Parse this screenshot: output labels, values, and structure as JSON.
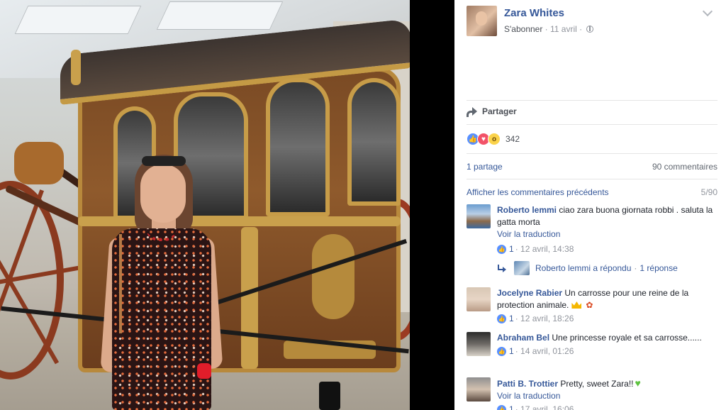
{
  "post": {
    "author": "Zara Whites",
    "follow_label": "S'abonner",
    "separator": " · ",
    "date": "11 avril",
    "share_label": "Partager",
    "reaction_count": "342",
    "shares": "1 partage",
    "comments_total": "90 commentaires",
    "view_previous": "Afficher les commentaires précédents",
    "comments_shown": "5/90"
  },
  "icons": {
    "chevron": "chevron-down-icon",
    "globe": "globe-icon",
    "share": "share-arrow-icon",
    "reactions": [
      "like-icon",
      "love-icon",
      "wow-icon"
    ]
  },
  "colors": {
    "link": "#365899",
    "meta": "#90949c",
    "like": "#5890ff",
    "love": "#f25268",
    "wow": "#fbd34a"
  },
  "comments": [
    {
      "author": "Roberto lemmi",
      "text": "ciao zara buona giornata robbi . saluta la gatta morta",
      "translate": "Voir la traduction",
      "likes": "1",
      "time": " · 12 avril, 14:38"
    },
    {
      "author": "Jocelyne Rabier",
      "text": "Un carrosse pour une reine de la protection animale.",
      "likes": "1",
      "time": " · 12 avril, 18:26"
    },
    {
      "author": "Abraham Bel",
      "text": "Une princesse royale et sa carrosse......",
      "likes": "1",
      "time": " · 14 avril, 01:26"
    },
    {
      "author": "Patti B. Trottier",
      "text": "Pretty, sweet Zara!!",
      "translate": "Voir la traduction",
      "likes": "1",
      "time": " · 17 avril, 16:06"
    }
  ],
  "reply": {
    "text": "Roberto lemmi a répondu",
    "sep": " · ",
    "count": "1 réponse"
  }
}
